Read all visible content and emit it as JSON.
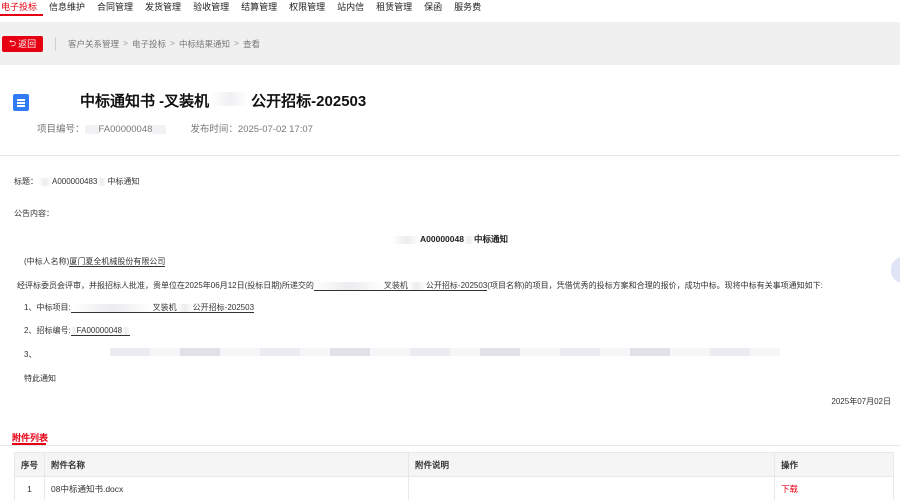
{
  "nav": {
    "items": [
      "电子投标",
      "信息维护",
      "合同管理",
      "发货管理",
      "验收管理",
      "结算管理",
      "权限管理",
      "站内信",
      "租赁管理",
      "保函",
      "服务费"
    ],
    "active_index": 0
  },
  "colors": {
    "accent": "#e60012",
    "doc_icon": "#2f7cf6"
  },
  "toolbar": {
    "back_label": "返回",
    "back_icon": "back-arrow-icon"
  },
  "breadcrumb": [
    "客户关系管理",
    "电子投标",
    "中标结果通知",
    "查看"
  ],
  "header": {
    "title_part1": "中标通知书 -叉装机",
    "title_part2": "公开招标-202503",
    "project_no_label": "项目编号：",
    "project_no_value": "FA00000048",
    "publish_label": "发布时间：",
    "publish_value": "2025-07-02 17:07"
  },
  "content": {
    "subject_label": "标题：",
    "subject_code": "A000000483",
    "subject_suffix": "中标通知",
    "announcement_label": "公告内容：",
    "center_title_code": "A00000048",
    "center_title_suffix": "中标通知",
    "winner_label": "(中标人名称)",
    "winner_name": "厦门夏全机械股份有限公司",
    "para_start": "经评标委员会评审，并报招标人批准，贵单位在2025年06月12日(投标日期)所递交的",
    "para_mid1": "叉装机",
    "para_mid2": "公开招标-202503",
    "para_end": "(项目名称)的项目，凭借优秀的投标方案和合理的报价，成功中标。现将中标有关事项通知如下:",
    "item1_label": "1、中标项目:",
    "item1_a": "叉装机",
    "item1_b": "公开招标-202503",
    "item2_label": "2、招标编号:",
    "item2_value": "FA00000048",
    "item3_label": "3、",
    "closing": "特此通知",
    "date": "2025年07月02日"
  },
  "attachments": {
    "title": "附件列表",
    "columns": [
      "序号",
      "附件名称",
      "附件说明",
      "操作"
    ],
    "rows": [
      {
        "idx": "1",
        "name": "08中标通知书.docx",
        "desc": "",
        "action": "下载"
      }
    ]
  }
}
